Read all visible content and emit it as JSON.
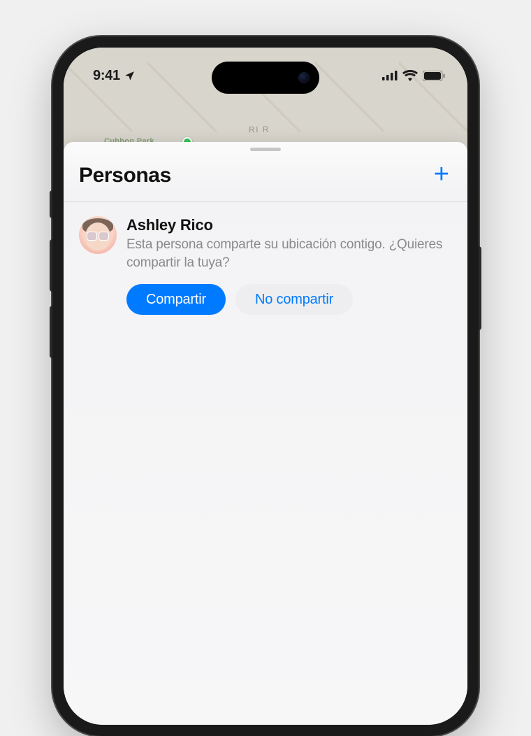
{
  "status": {
    "time": "9:41",
    "location_icon": "location-arrow"
  },
  "sheet": {
    "title": "Personas",
    "add_label": "+"
  },
  "person": {
    "name": "Ashley Rico",
    "subtitle": "Esta persona comparte su ubicación contigo. ¿Quieres compartir la tuya?",
    "share_label": "Compartir",
    "dont_share_label": "No compartir"
  },
  "map": {
    "park_label": "Cubbon Park",
    "road_label": "RI R"
  }
}
